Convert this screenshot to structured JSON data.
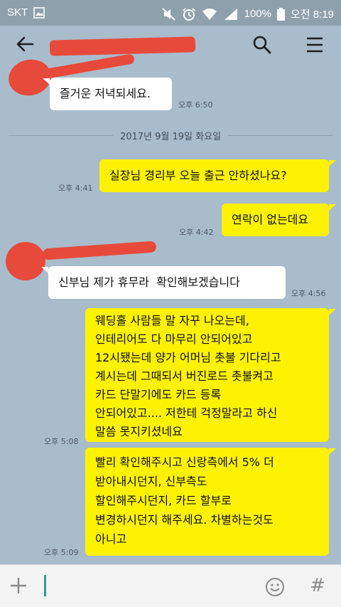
{
  "status_bar": {
    "carrier": "SKT",
    "battery": "100%",
    "time": "오전 8:19"
  },
  "header": {
    "title": ""
  },
  "chat": {
    "date_divider": "2017년 9월 19일 화요일",
    "messages": [
      {
        "side": "in",
        "text": "즐거운 저녁되세요.",
        "time": "오후 6:50"
      },
      {
        "side": "out",
        "text": "실장님 경리부 오늘 출근 안하셨나요?",
        "time": "오후 4:41"
      },
      {
        "side": "out",
        "text": "연락이 없는데요",
        "time": "오후 4:42"
      },
      {
        "side": "in",
        "text": "신부님 제가 휴무라  확인해보겠습니다",
        "time": "오후 4:56"
      },
      {
        "side": "out",
        "text": "웨딩홀 사람들 말 자꾸 나오는데,\n인테리어도 다 마무리 안되어있고\n12시됐는데 양가 어머님 촛불 기다리고\n계시는데 그때되서 버진로드 촛불켜고\n카드 단말기에도 카드 등록\n안되어있고.... 저한테 걱정말라고 하신\n말씀 못지키셨네요",
        "time": "오후 5:08"
      },
      {
        "side": "out",
        "text": "빨리 확인해주시고 신랑측에서 5% 더\n받아내시던지, 신부측도\n할인해주시던지, 카드 할부로\n변경하시던지 해주세요. 차별하는것도\n아니고",
        "time": "오후 5:09"
      }
    ]
  },
  "input_bar": {
    "value": "",
    "hash_label": "#"
  },
  "colors": {
    "background": "#a9bccc",
    "my_bubble": "#fef200",
    "their_bubble": "#ffffff",
    "redaction": "#e74a3a"
  }
}
